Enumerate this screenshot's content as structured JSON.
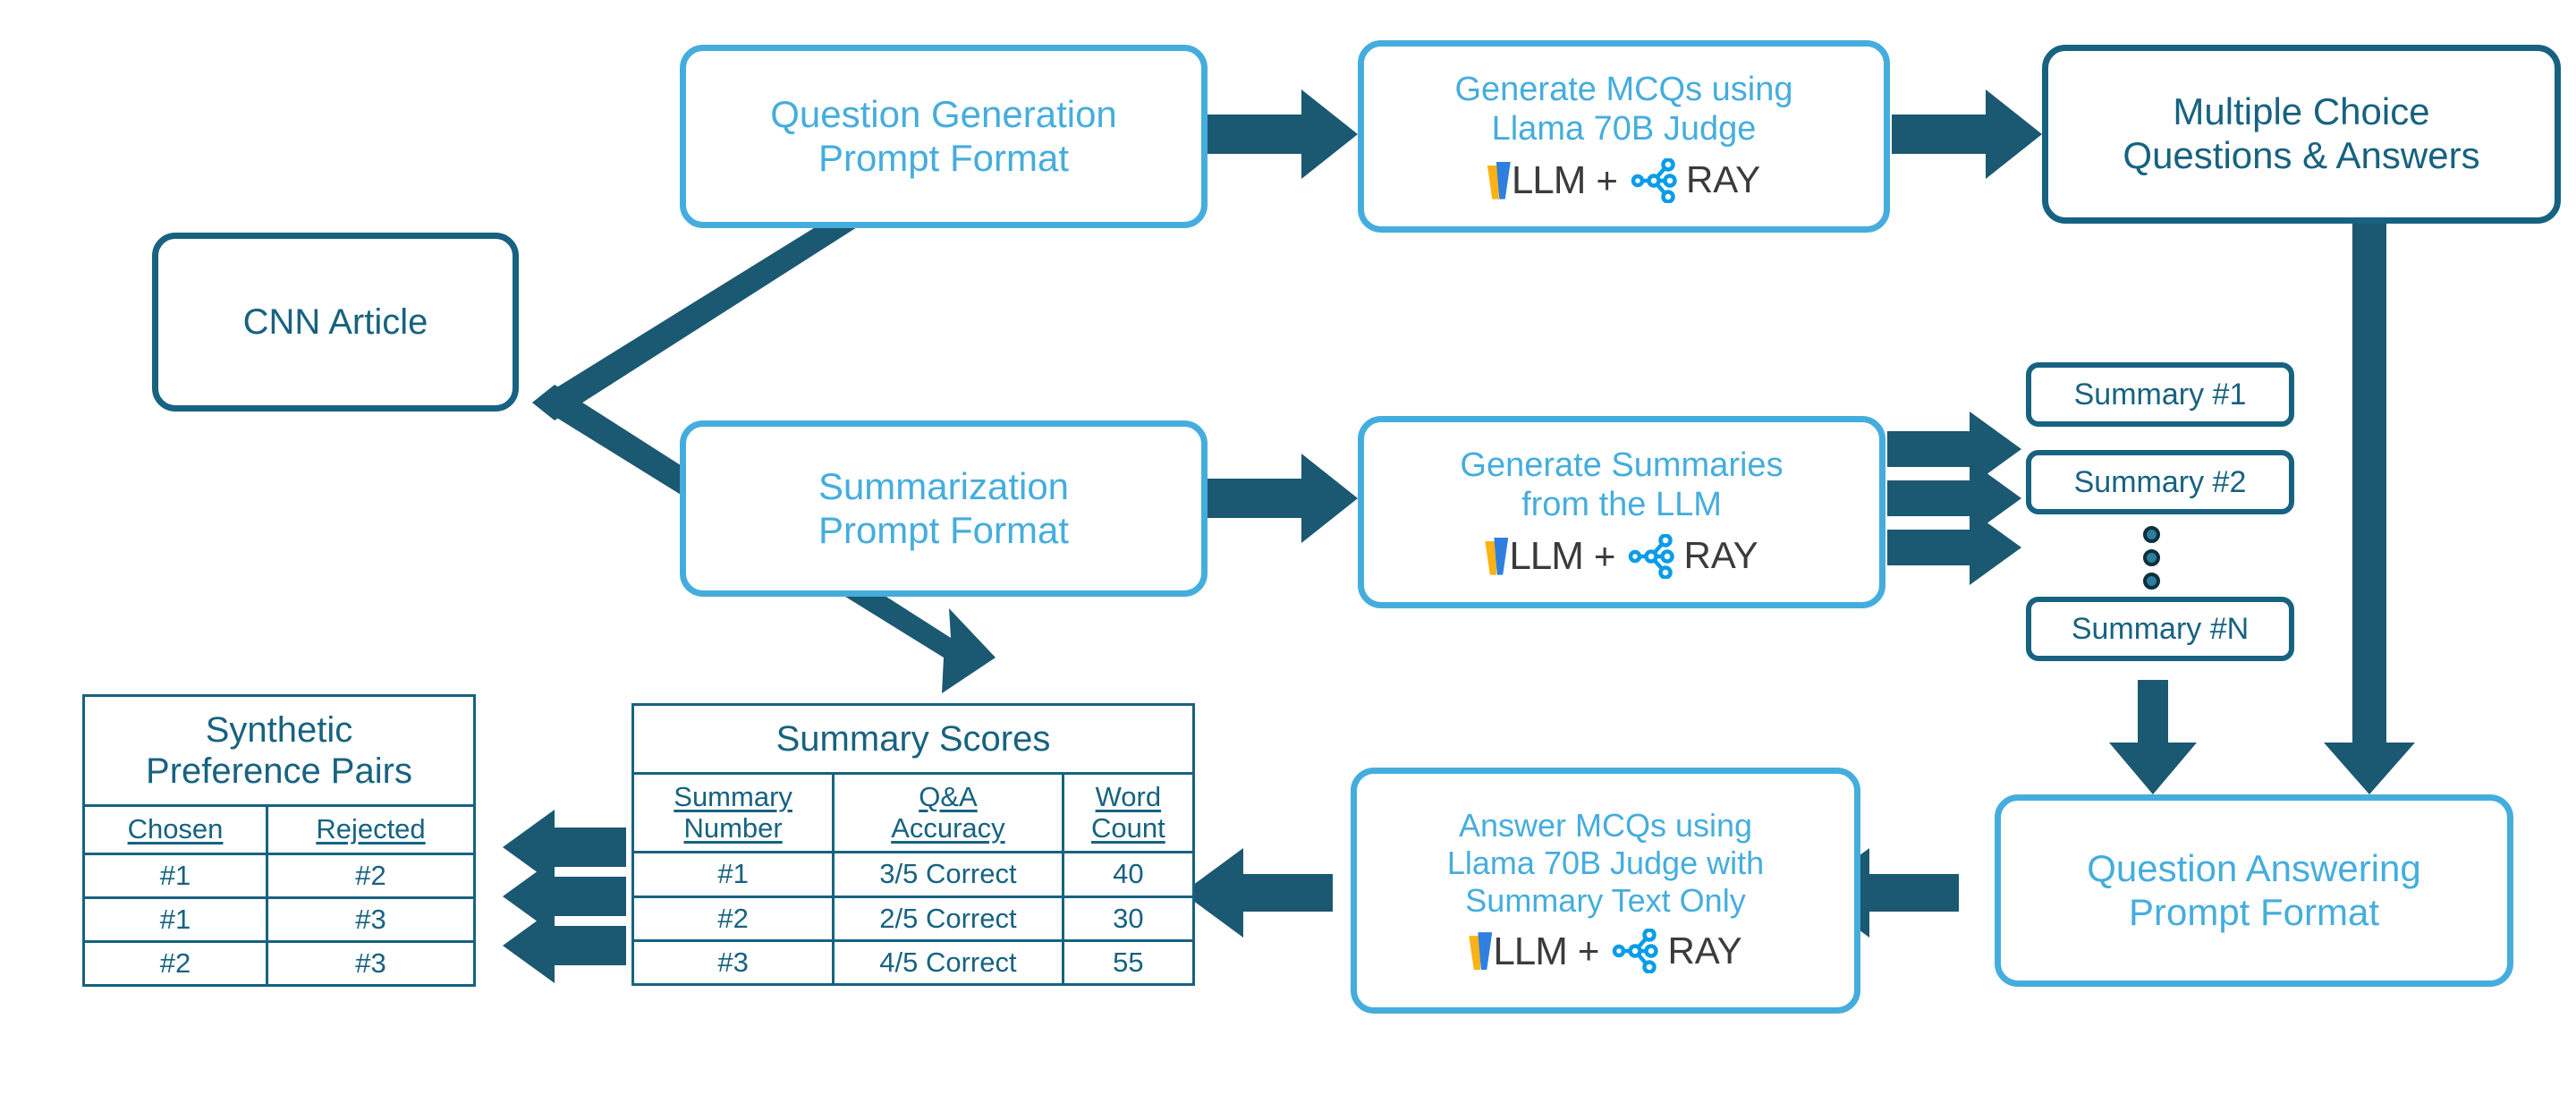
{
  "colors": {
    "dark_teal": "#176280",
    "light_blue": "#45ADDD",
    "arrow": "#1B5871",
    "vllm_yellow": "#FBB216",
    "vllm_blue": "#2E7FE0",
    "ray_blue": "#0B9CE8"
  },
  "nodes": {
    "cnn_article": {
      "label": "CNN Article"
    },
    "question_generation_prompt": {
      "line1": "Question Generation",
      "line2": "Prompt Format"
    },
    "generate_mcqs": {
      "line1": "Generate MCQs using",
      "line2": "Llama 70B Judge"
    },
    "mcq_answers": {
      "line1": "Multiple Choice",
      "line2": "Questions & Answers"
    },
    "summarization_prompt": {
      "line1": "Summarization",
      "line2": "Prompt Format"
    },
    "generate_summaries": {
      "line1": "Generate Summaries",
      "line2": "from the LLM"
    },
    "answer_mcqs": {
      "line1": "Answer MCQs using",
      "line2": "Llama 70B Judge with",
      "line3": "Summary Text Only"
    },
    "question_answering_prompt": {
      "line1": "Question Answering",
      "line2": "Prompt Format"
    }
  },
  "logo": {
    "vllm_text": "LLM",
    "plus": "+",
    "ray_text": "RAY"
  },
  "summaries": [
    {
      "label": "Summary #1"
    },
    {
      "label": "Summary #2"
    },
    {
      "label": "Summary #N"
    }
  ],
  "summary_scores_table": {
    "title": "Summary Scores",
    "headers": [
      {
        "line1": "Summary",
        "line2": "Number"
      },
      {
        "line1": "Q&A",
        "line2": "Accuracy"
      },
      {
        "line1": "Word",
        "line2": "Count"
      }
    ],
    "rows": [
      {
        "number": "#1",
        "accuracy": "3/5 Correct",
        "word_count": "40"
      },
      {
        "number": "#2",
        "accuracy": "2/5 Correct",
        "word_count": "30"
      },
      {
        "number": "#3",
        "accuracy": "4/5 Correct",
        "word_count": "55"
      }
    ]
  },
  "preference_pairs_table": {
    "title_line1": "Synthetic",
    "title_line2": "Preference Pairs",
    "headers": [
      "Chosen",
      "Rejected"
    ],
    "rows": [
      {
        "chosen": "#1",
        "rejected": "#2"
      },
      {
        "chosen": "#1",
        "rejected": "#3"
      },
      {
        "chosen": "#2",
        "rejected": "#3"
      }
    ]
  }
}
